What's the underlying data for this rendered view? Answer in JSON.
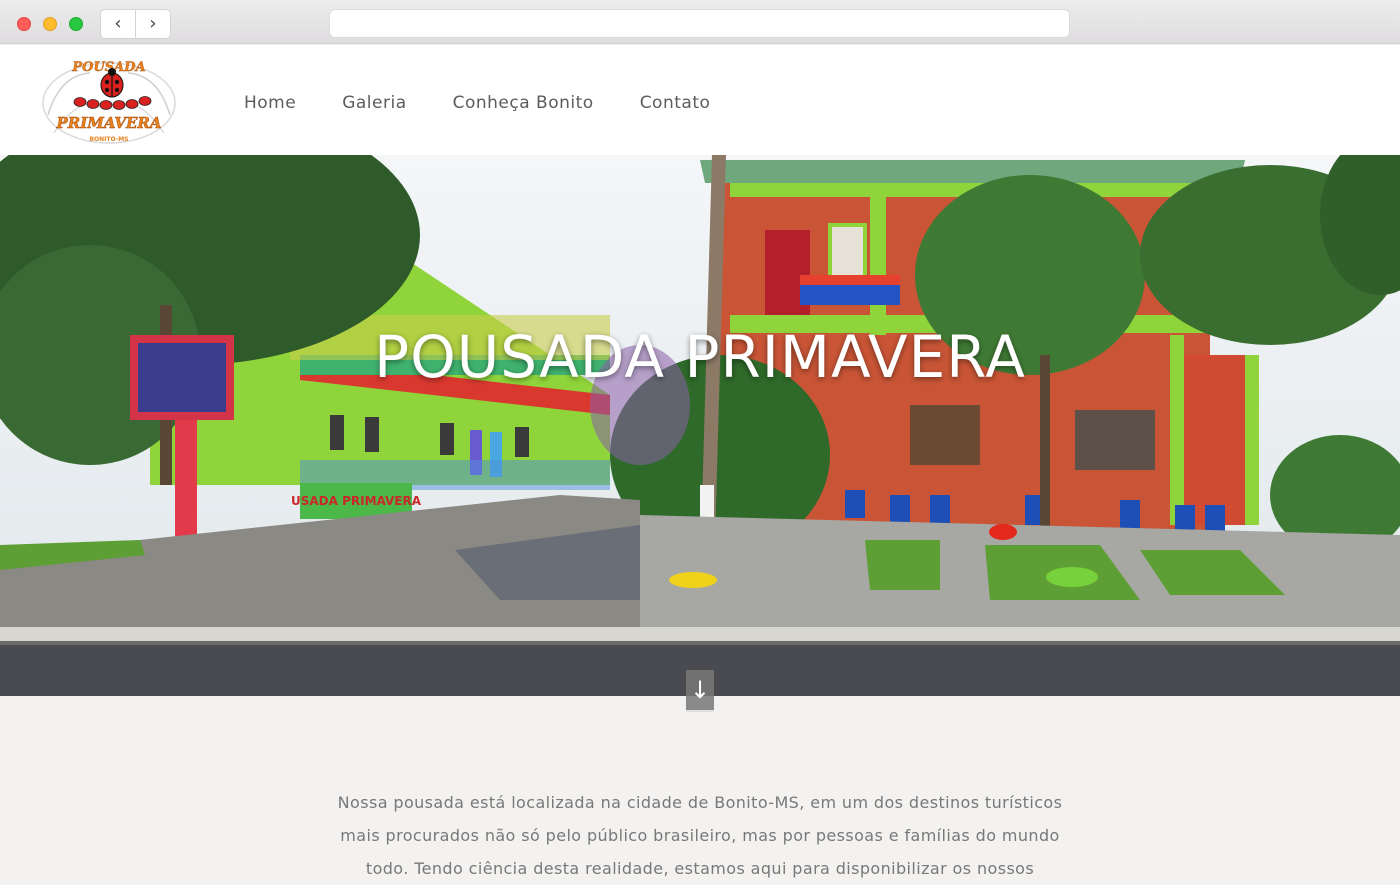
{
  "browser": {
    "back_icon": "chevron-left-icon",
    "forward_icon": "chevron-right-icon",
    "url": ""
  },
  "logo": {
    "line1": "POUSADA",
    "line2": "PRIMAVERA",
    "line3": "BONITO-MS"
  },
  "nav": {
    "items": [
      "Home",
      "Galeria",
      "Conheça Bonito",
      "Contato"
    ]
  },
  "hero": {
    "title": "POUSADA PRIMAVERA",
    "sign_text": "USADA PRIMAVERA",
    "scroll_icon": "arrow-down-icon"
  },
  "intro": {
    "text": "Nossa pousada está localizada na cidade de Bonito-MS, em um dos destinos turísticos mais procurados não só pelo público brasileiro, mas por pessoas e famílias do mundo todo. Tendo ciência desta realidade, estamos aqui para disponibilizar os nossos"
  },
  "colors": {
    "accent": "#e8821e",
    "nav_text": "#5c5c5c",
    "body_text": "#787878",
    "page_bg": "#f3f2f0"
  }
}
